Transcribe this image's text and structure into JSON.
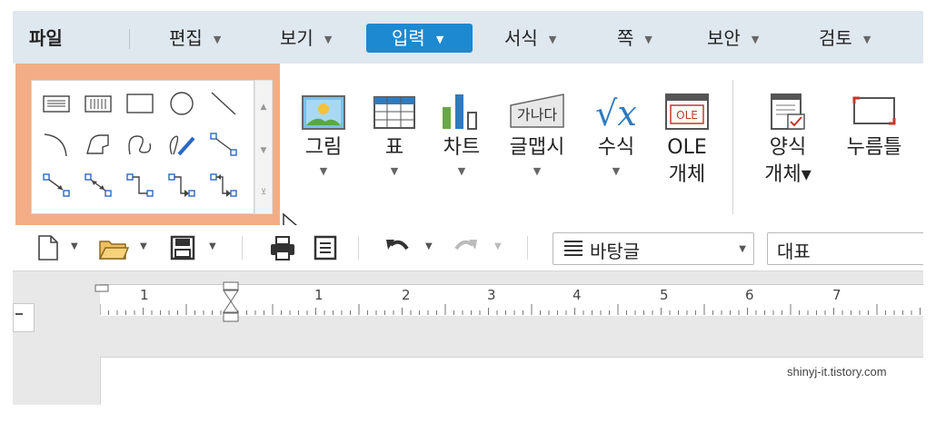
{
  "menubar": {
    "file": "파일",
    "items": [
      {
        "label": "편집"
      },
      {
        "label": "보기"
      },
      {
        "label": "입력"
      },
      {
        "label": "서식"
      },
      {
        "label": "쪽"
      },
      {
        "label": "보안"
      },
      {
        "label": "검토"
      }
    ],
    "active": "입력",
    "arrow": "▼"
  },
  "ribbon": {
    "buttons": [
      {
        "label": "그림",
        "arrow": "▼"
      },
      {
        "label": "표",
        "arrow": "▼"
      },
      {
        "label": "차트",
        "arrow": "▼"
      },
      {
        "label": "글맵시",
        "arrow": "▼"
      },
      {
        "label": "수식",
        "arrow": "▼"
      },
      {
        "label": "OLE",
        "label2": "개체"
      },
      {
        "label": "양식",
        "label2": "개체▾"
      },
      {
        "label": "누름틀"
      }
    ],
    "icons": {
      "glmapsi_text": "가나다",
      "ole_text": "OLE",
      "formula_text": "√x"
    }
  },
  "toolbar": {
    "style_combo": "바탕글",
    "font_combo": "대표"
  },
  "ruler": {
    "numbers": [
      "1",
      "1",
      "2",
      "3",
      "4",
      "5",
      "6",
      "7"
    ]
  },
  "watermark": "shinyj-it.tistory.com",
  "colors": {
    "accent": "#1d89d0",
    "highlight": "#f2ad86",
    "menubar_bg": "#dfe7ef"
  }
}
